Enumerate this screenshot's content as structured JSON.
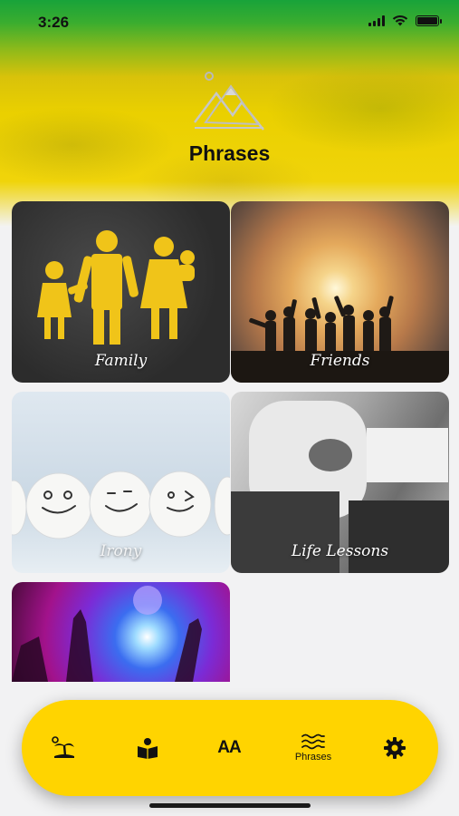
{
  "status_bar": {
    "time": "3:26"
  },
  "header": {
    "title": "Phrases"
  },
  "categories": [
    {
      "label": "Family"
    },
    {
      "label": "Friends"
    },
    {
      "label": "Irony"
    },
    {
      "label": "Life Lessons"
    },
    {
      "label": ""
    }
  ],
  "tabbar": {
    "tabs": [
      {
        "icon": "island-icon",
        "label": ""
      },
      {
        "icon": "reading-icon",
        "label": ""
      },
      {
        "icon": "font-size-icon",
        "label": "",
        "glyph": "AA"
      },
      {
        "icon": "waves-icon",
        "label": "Phrases",
        "selected": true
      },
      {
        "icon": "gear-icon",
        "label": ""
      }
    ]
  },
  "colors": {
    "tabbar": "#ffd400",
    "header_top": "#18a33a",
    "header_bottom": "#ead000"
  }
}
